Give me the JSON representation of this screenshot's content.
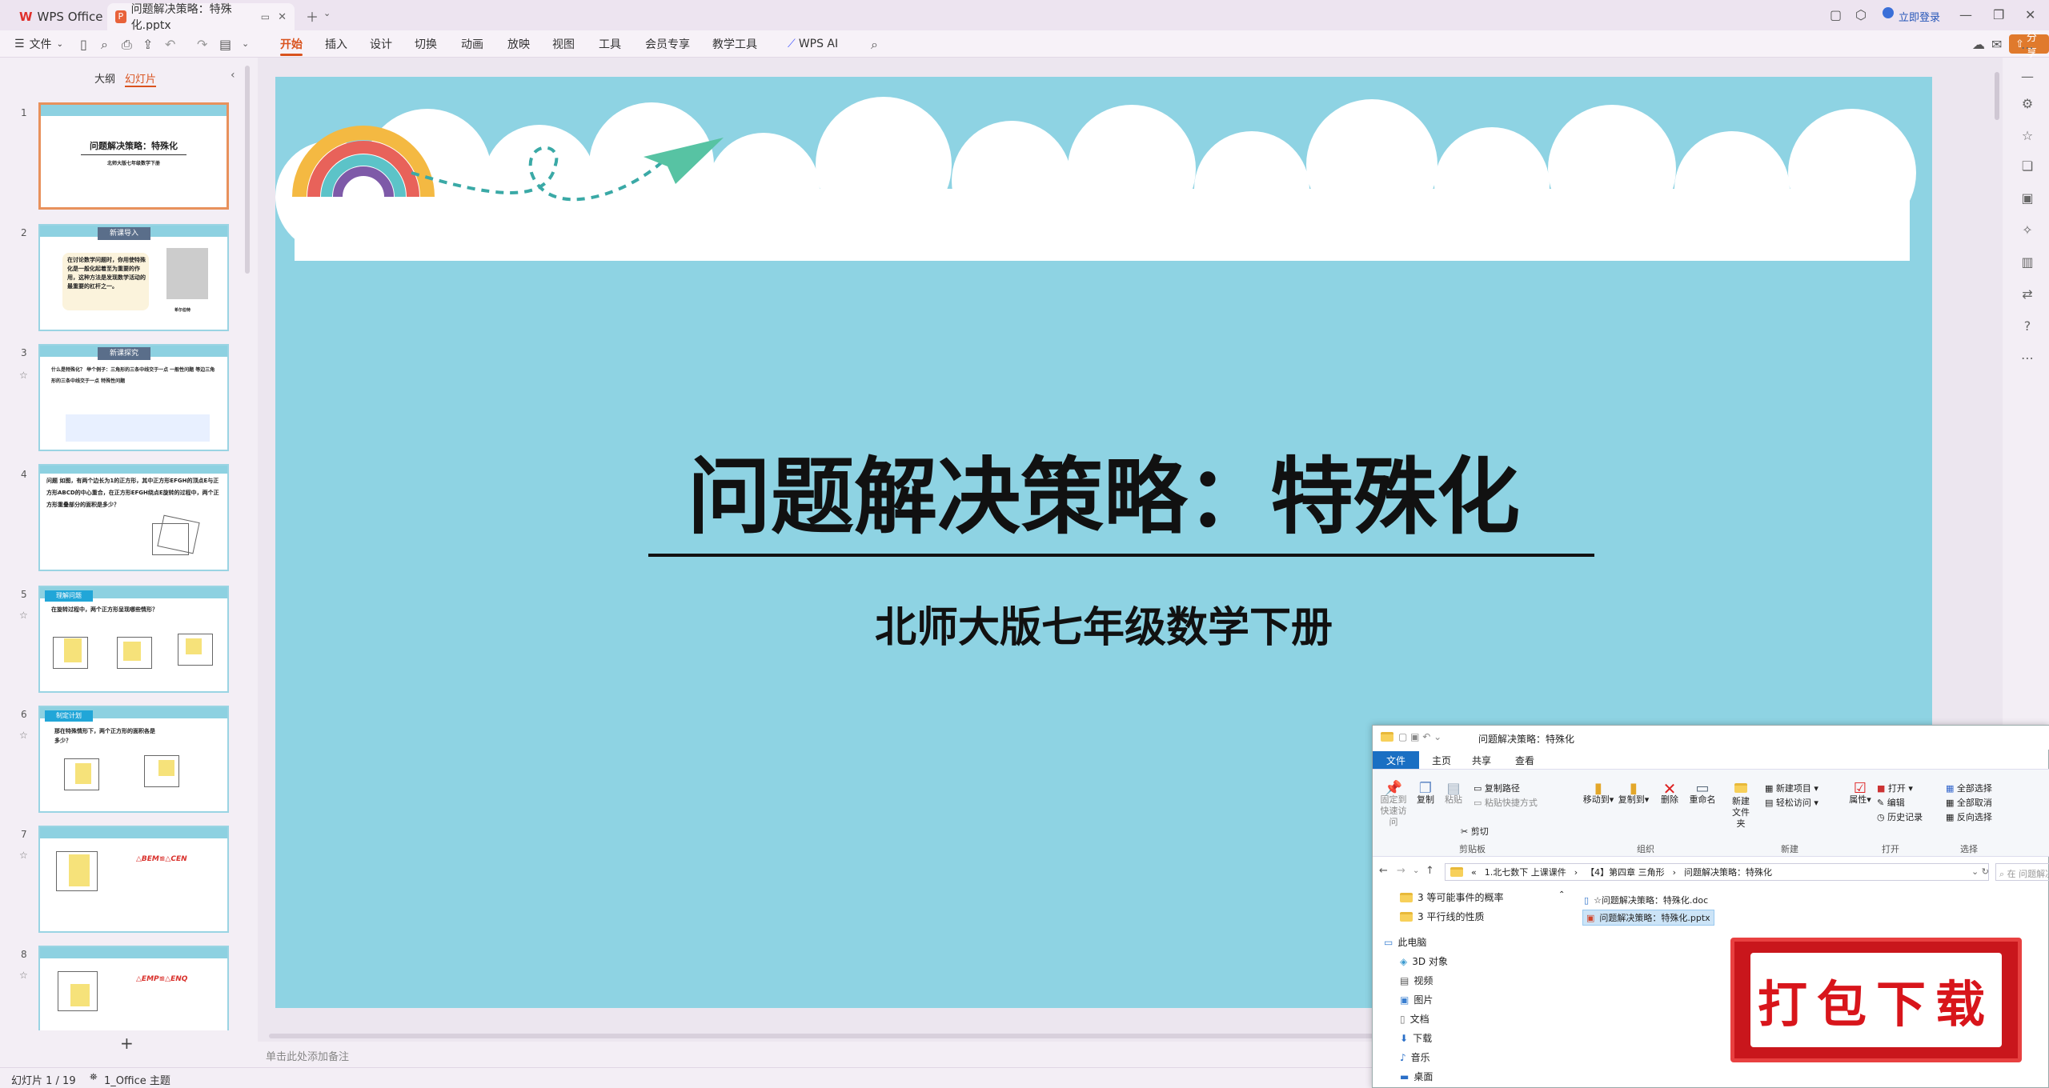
{
  "titlebar": {
    "app_tab": "WPS Office",
    "doc_tab": "问题解决策略：特殊化.pptx",
    "login": "立即登录"
  },
  "menubar": {
    "file": "文件",
    "items": [
      "开始",
      "插入",
      "设计",
      "切换",
      "动画",
      "放映",
      "视图",
      "工具",
      "会员专享",
      "教学工具"
    ],
    "wps_ai": "WPS AI",
    "share": "分享"
  },
  "leftpanel": {
    "tab_outline": "大纲",
    "tab_slides": "幻灯片",
    "thumbs": [
      {
        "num": "1",
        "title": "问题解决策略：特殊化",
        "sub": "北师大版七年级数学下册"
      },
      {
        "num": "2",
        "header": "新课导入",
        "text": "在讨论数学问题时，你用使特殊化是一般化起着至为重要的作用，这种方法是发现数学活动的最重要的杠杆之一。",
        "caption": "希尔伯特"
      },
      {
        "num": "3",
        "header": "新课探究",
        "text": "什么是特殊化？ 举个例子：三角形的三条中线交于一点 一般性问题 等边三角形的三条中线交于一点 特殊性问题"
      },
      {
        "num": "4",
        "text": "问题 如图，有两个边长为1的正方形，其中正方形EFGH的顶点E与正方形ABCD的中心重合，在正方形EFGH绕点E旋转的过程中，两个正方形重叠部分的面积是多少？"
      },
      {
        "num": "5",
        "header": "理解问题",
        "text": "在旋转过程中，两个正方形呈现哪些情形？"
      },
      {
        "num": "6",
        "header": "制定计划",
        "text": "那在特殊情形下，两个正方形的面积各是多少？"
      },
      {
        "num": "7",
        "text": "△BEM≌△CEN"
      },
      {
        "num": "8",
        "text": "△EMP≌△ENQ"
      }
    ],
    "add": "+"
  },
  "slide": {
    "title": "问题解决策略：特殊化",
    "subtitle": "北师大版七年级数学下册"
  },
  "notes_placeholder": "单击此处添加备注",
  "statusbar": {
    "slide_pos": "幻灯片 1 / 19",
    "theme": "1_Office 主题"
  },
  "explorer": {
    "title": "问题解决策略：特殊化",
    "tabs": [
      "文件",
      "主页",
      "共享",
      "查看"
    ],
    "clipboard": {
      "pin": "固定到快速访问",
      "copy": "复制",
      "paste": "粘贴",
      "copy_path": "复制路径",
      "paste_shortcut": "粘贴快捷方式",
      "cut": "剪切",
      "group": "剪贴板"
    },
    "organize": {
      "move": "移动到",
      "copyto": "复制到",
      "delete": "删除",
      "rename": "重命名",
      "group": "组织"
    },
    "new": {
      "folder": "新建文件夹",
      "item": "新建项目",
      "easy": "轻松访问",
      "group": "新建"
    },
    "open": {
      "props": "属性",
      "open": "打开",
      "edit": "编辑",
      "history": "历史记录",
      "group": "打开"
    },
    "select": {
      "all": "全部选择",
      "none": "全部取消",
      "invert": "反向选择",
      "group": "选择"
    },
    "breadcrumb": [
      "«",
      "1.北七数下 上课课件",
      "【4】第四章 三角形",
      "问题解决策略：特殊化"
    ],
    "search_placeholder": "在 问题解决...",
    "tree": [
      "3 等可能事件的概率",
      "3 平行线的性质",
      "此电脑",
      "3D 对象",
      "视频",
      "图片",
      "文档",
      "下载",
      "音乐",
      "桌面"
    ],
    "files": [
      "☆问题解决策略：特殊化.doc",
      "问题解决策略：特殊化.pptx"
    ]
  },
  "badge": {
    "text": "打包下载"
  }
}
